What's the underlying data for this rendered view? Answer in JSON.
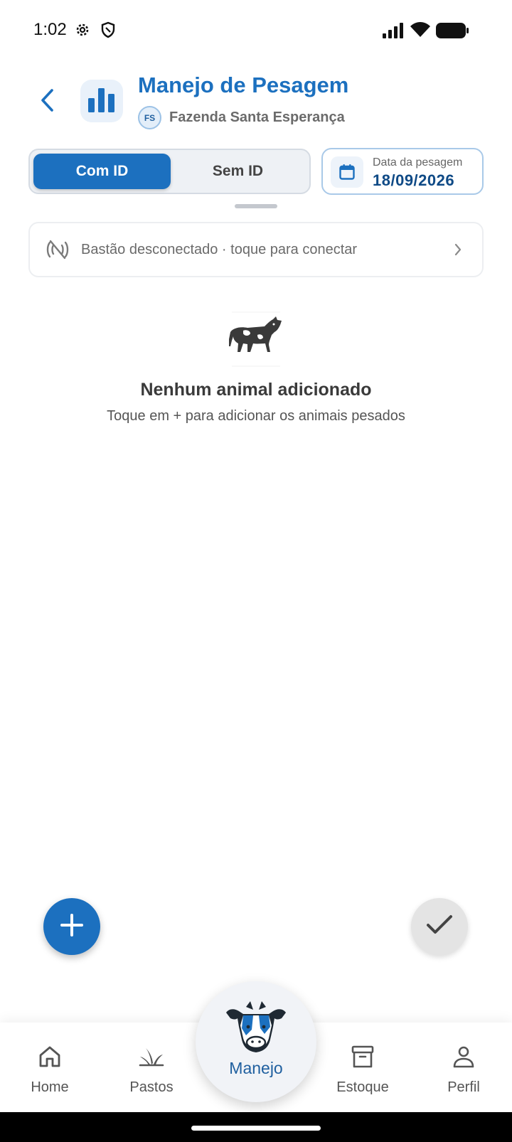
{
  "status_bar": {
    "time": "1:02",
    "icons": [
      "gear-icon",
      "shield-icon",
      "signal-icon",
      "wifi-icon",
      "battery-icon"
    ]
  },
  "header": {
    "title": "Manejo de Pesagem",
    "farm_initials": "FS",
    "farm_name": "Fazenda Santa Esperança",
    "back_icon": "chevron-left-icon",
    "badge_icon": "bar-chart-icon"
  },
  "mode_toggle": {
    "options": [
      "Com ID",
      "Sem ID"
    ],
    "selected": "Com ID"
  },
  "date_picker": {
    "label": "Data da pesagem",
    "value": "18/09/2026",
    "icon": "calendar-icon"
  },
  "connection": {
    "text": "Bastão desconectado · toque para conectar",
    "icon": "disconnected-icon"
  },
  "empty_state": {
    "icon": "cow-icon",
    "title": "Nenhum animal adicionado",
    "subtitle": "Toque em + para adicionar os animais pesados"
  },
  "actions": {
    "add_icon": "plus-icon",
    "confirm_icon": "check-icon"
  },
  "bottom_nav": {
    "items": [
      {
        "label": "Home",
        "icon": "home-icon"
      },
      {
        "label": "Pastos",
        "icon": "grass-icon"
      },
      {
        "label": "Manejo",
        "icon": "cow-head-icon"
      },
      {
        "label": "Estoque",
        "icon": "archive-icon"
      },
      {
        "label": "Perfil",
        "icon": "person-icon"
      }
    ],
    "active": "Manejo"
  },
  "colors": {
    "primary": "#1c70bf",
    "primary_dark": "#0f4a86",
    "text_muted": "#6b6b6b"
  }
}
